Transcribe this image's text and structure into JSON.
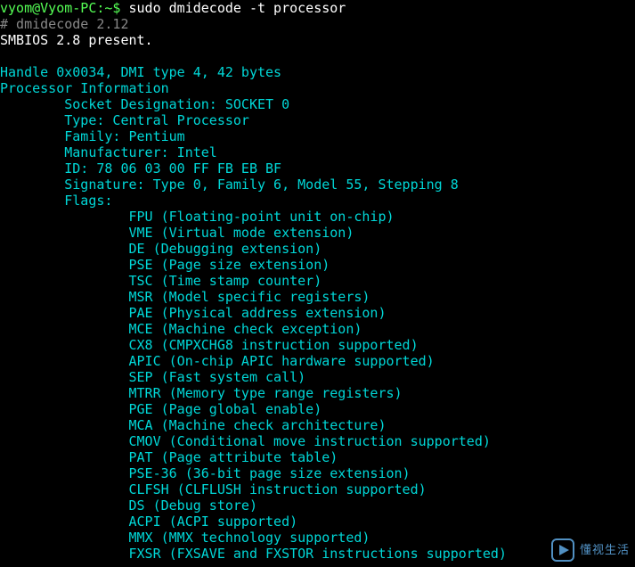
{
  "prompt": "vyom@Vyom-PC:~$ ",
  "command": "sudo dmidecode -t processor",
  "header1": "# dmidecode 2.12",
  "header2": "SMBIOS 2.8 present.",
  "handle": "Handle 0x0034, DMI type 4, 42 bytes",
  "section": "Processor Information",
  "fields": {
    "socket": "        Socket Designation: SOCKET 0",
    "type": "        Type: Central Processor",
    "family": "        Family: Pentium",
    "manuf": "        Manufacturer: Intel",
    "id": "        ID: 78 06 03 00 FF FB EB BF",
    "sig": "        Signature: Type 0, Family 6, Model 55, Stepping 8",
    "flags": "        Flags:"
  },
  "flags": [
    "                FPU (Floating-point unit on-chip)",
    "                VME (Virtual mode extension)",
    "                DE (Debugging extension)",
    "                PSE (Page size extension)",
    "                TSC (Time stamp counter)",
    "                MSR (Model specific registers)",
    "                PAE (Physical address extension)",
    "                MCE (Machine check exception)",
    "                CX8 (CMPXCHG8 instruction supported)",
    "                APIC (On-chip APIC hardware supported)",
    "                SEP (Fast system call)",
    "                MTRR (Memory type range registers)",
    "                PGE (Page global enable)",
    "                MCA (Machine check architecture)",
    "                CMOV (Conditional move instruction supported)",
    "                PAT (Page attribute table)",
    "                PSE-36 (36-bit page size extension)",
    "                CLFSH (CLFLUSH instruction supported)",
    "                DS (Debug store)",
    "                ACPI (ACPI supported)",
    "                MMX (MMX technology supported)",
    "                FXSR (FXSAVE and FXSTOR instructions supported)"
  ],
  "watermark": "懂视生活"
}
